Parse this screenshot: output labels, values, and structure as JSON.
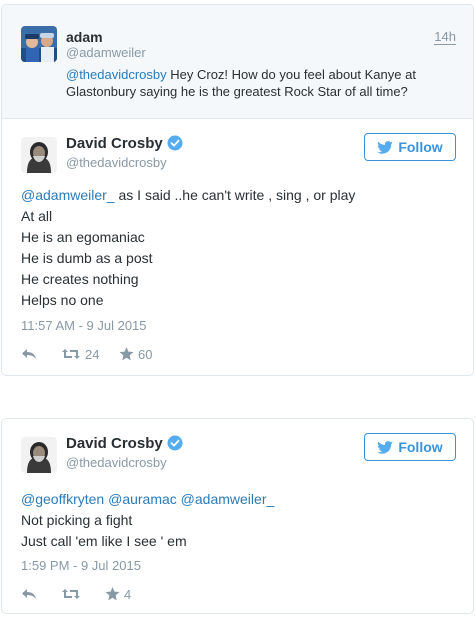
{
  "parent_tweet": {
    "name": "adam",
    "handle": "@adamweiler",
    "time": "14h",
    "mention": "@thedavidcrosby",
    "text": " Hey Croz! How do you feel about Kanye at Glastonbury saying he is the greatest Rock Star of all time?"
  },
  "tweets": [
    {
      "name": "David Crosby",
      "handle": "@thedavidcrosby",
      "follow_label": "Follow",
      "mentions": "@adamweiler_",
      "first_line_rest": " as I said ..he can't write , sing , or play",
      "lines": [
        "At all",
        "He is an egomaniac",
        "He is dumb as a post",
        "He creates nothing",
        "Helps no one"
      ],
      "timestamp": "11:57 AM - 9 Jul 2015",
      "retweets": "24",
      "favorites": "60"
    },
    {
      "name": "David Crosby",
      "handle": "@thedavidcrosby",
      "follow_label": "Follow",
      "mentions": "@geoffkryten @auramac @adamweiler_",
      "lines": [
        "Not picking a fight",
        "Just call 'em like I see ' em"
      ],
      "timestamp": "1:59 PM - 9 Jul 2015",
      "retweets": "",
      "favorites": "4"
    }
  ],
  "colors": {
    "link": "#2b7bb9",
    "follow": "#3b94d9",
    "muted": "#8899a6",
    "parent_bg": "#f5f8fa"
  },
  "icons": [
    "verified-badge-icon",
    "twitter-bird-icon",
    "reply-icon",
    "retweet-icon",
    "favorite-star-icon"
  ]
}
